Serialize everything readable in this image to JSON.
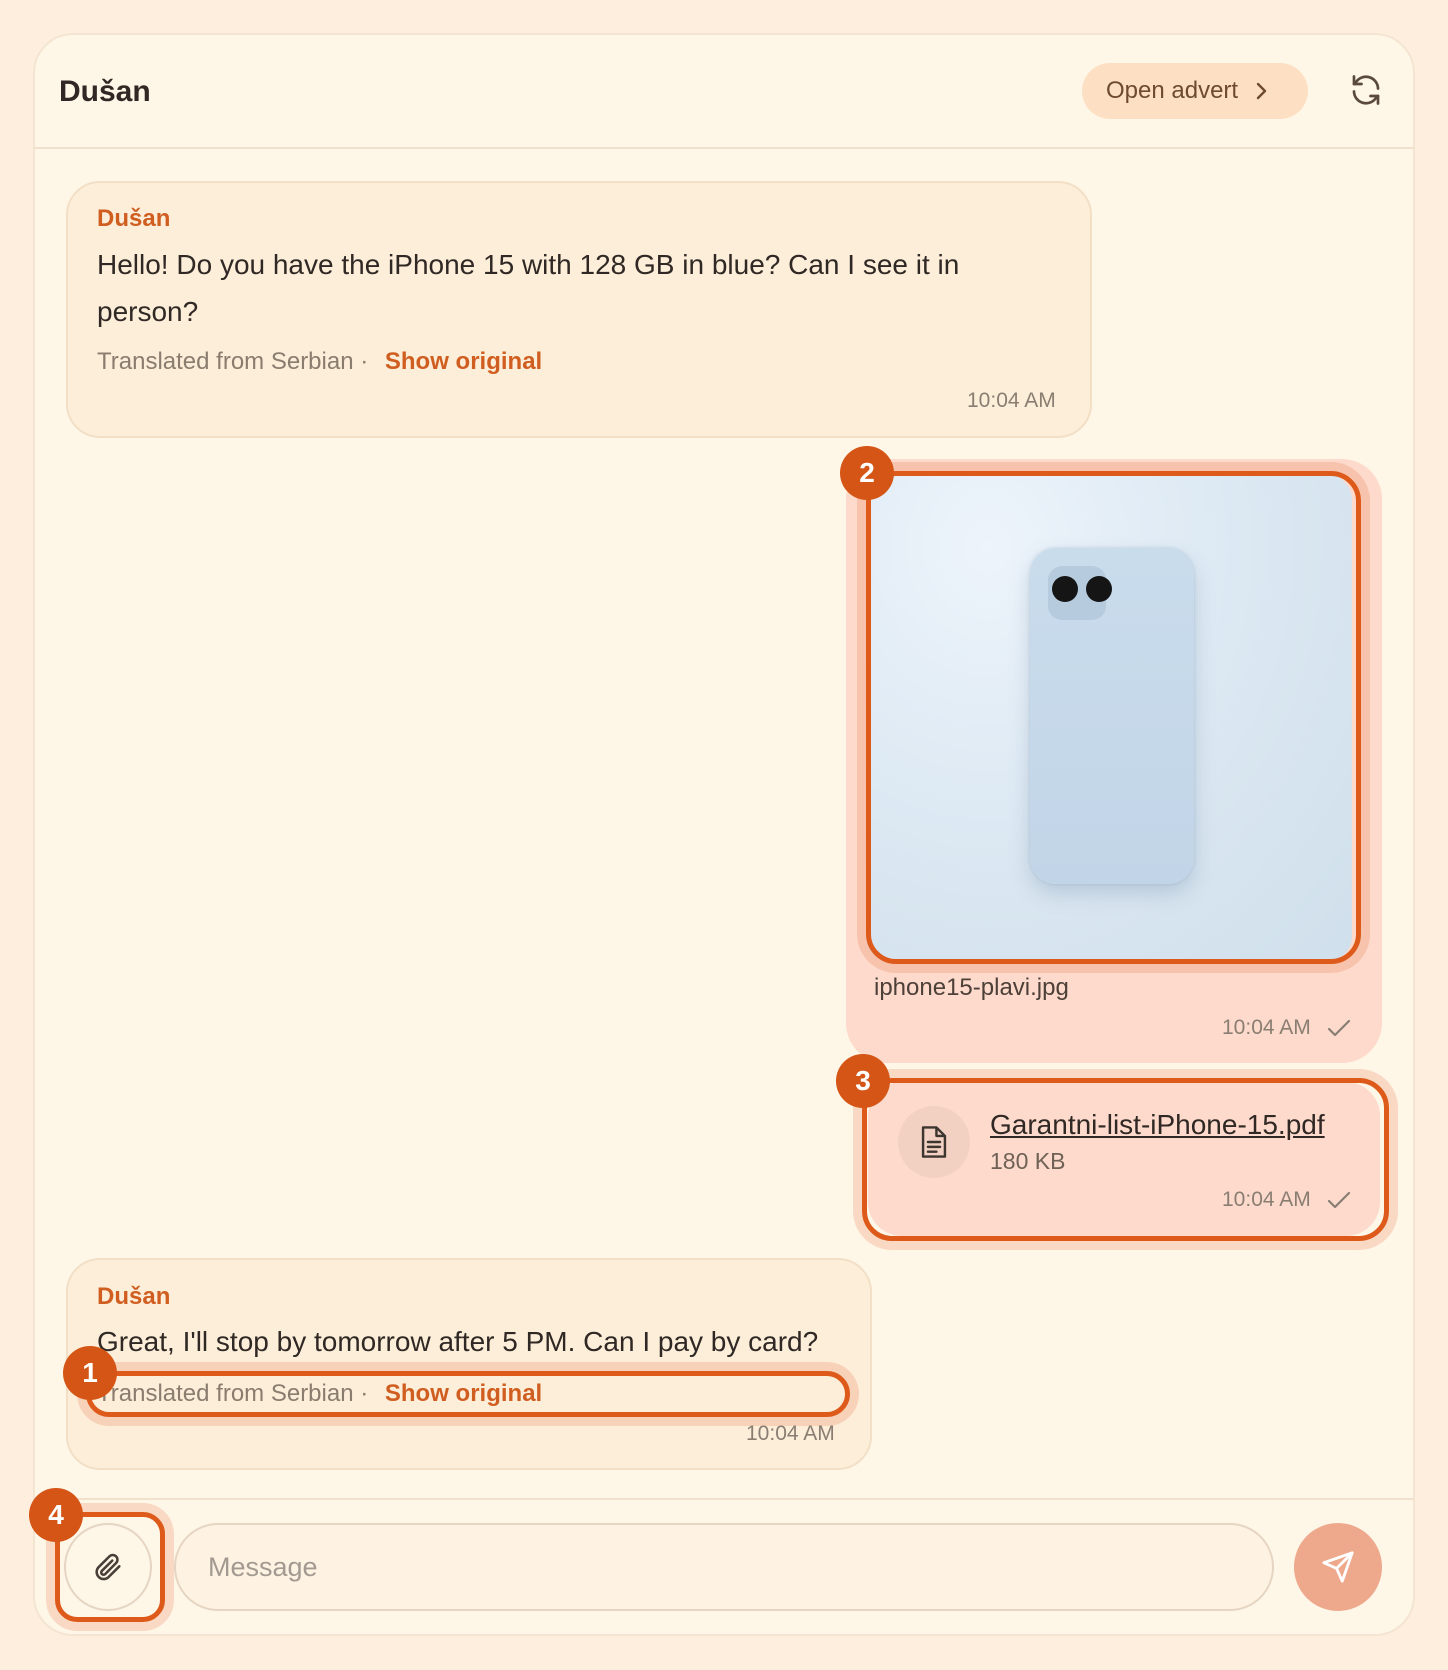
{
  "header": {
    "title": "Dušan",
    "open_advert_label": "Open advert",
    "refresh_icon": "refresh-icon"
  },
  "messages": [
    {
      "sender": "Dušan",
      "text": "Hello! Do you have the iPhone 15 with 128 GB in blue? Can I see it in person?",
      "translated_label": "Translated from Serbian ·",
      "show_original": "Show original",
      "time": "10:04 AM"
    },
    {
      "image_name": "iphone15-plavi.jpg",
      "time": "10:04 AM"
    },
    {
      "file_name": "Garantni-list-iPhone-15.pdf",
      "file_size": "180 KB",
      "time": "10:04 AM"
    },
    {
      "sender": "Dušan",
      "text": "Great, I'll stop by tomorrow after 5 PM. Can I pay by card?",
      "translated_label": "Translated from Serbian ·",
      "show_original": "Show original",
      "time": "10:04 AM"
    }
  ],
  "composer": {
    "placeholder": "Message",
    "attach_icon": "paperclip-icon",
    "send_icon": "send-icon"
  },
  "annotations": {
    "badge_1": "1",
    "badge_2": "2",
    "badge_3": "3",
    "badge_4": "4"
  },
  "colors": {
    "accent": "#d05e20",
    "highlight": "#dd5a1b",
    "background": "#fdeedd",
    "incoming_bubble": "#fdeed9",
    "outgoing_bubble": "#fddacb",
    "send_button": "#eea98c"
  }
}
